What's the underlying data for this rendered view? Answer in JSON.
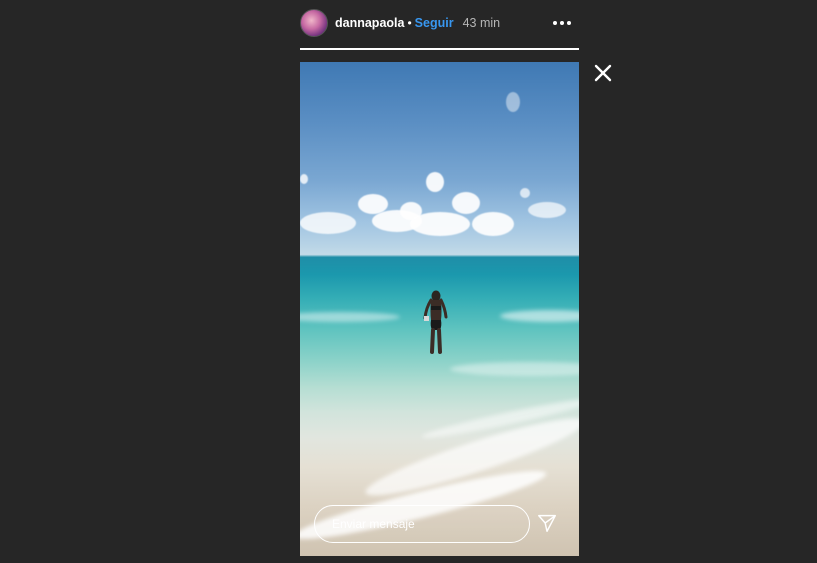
{
  "header": {
    "username": "dannapaola",
    "separator": "•",
    "follow_label": "Seguir",
    "time": "43 min"
  },
  "progress": {
    "segments": 1,
    "current": 1
  },
  "reply": {
    "placeholder": "Enviar mensaje"
  },
  "icons": {
    "more": "more-horizontal-icon",
    "close": "close-icon",
    "send": "send-icon"
  },
  "colors": {
    "background": "#262626",
    "follow": "#3897f0",
    "text": "#ffffff",
    "time": "#b5b5b5"
  }
}
